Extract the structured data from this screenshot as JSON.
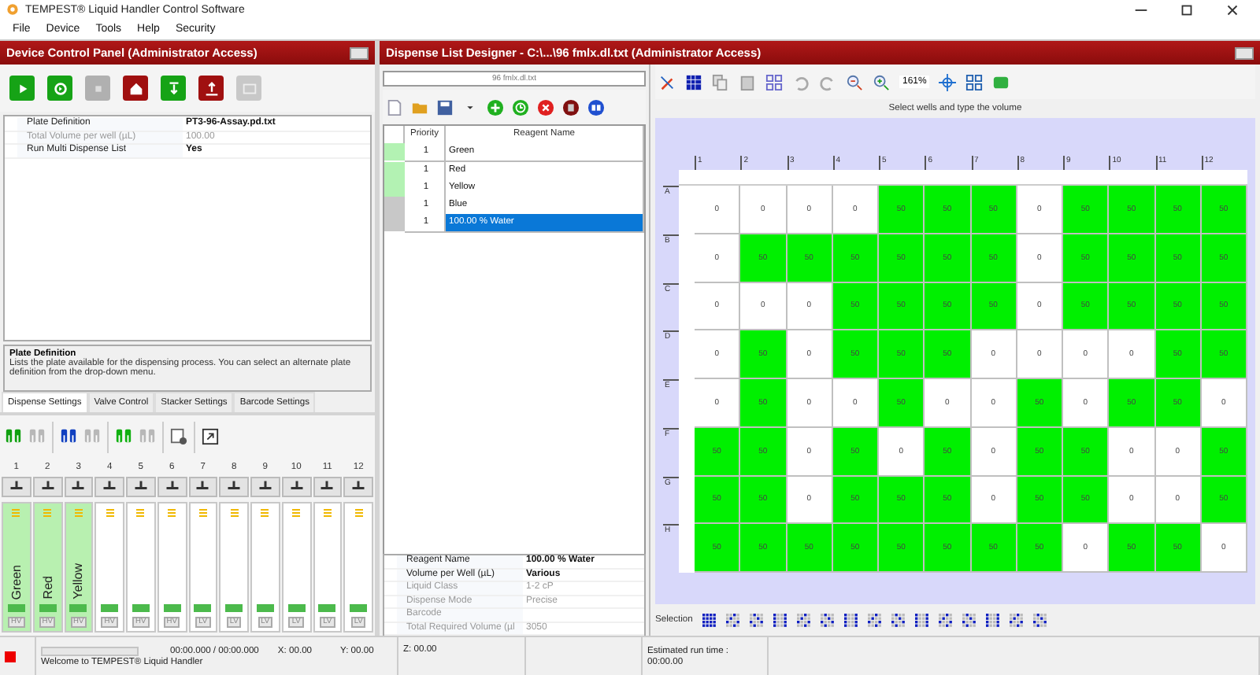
{
  "window": {
    "title": "TEMPEST® Liquid Handler Control Software"
  },
  "menu": [
    "File",
    "Device",
    "Tools",
    "Help",
    "Security"
  ],
  "device_panel": {
    "title": "Device Control Panel (Administrator Access)",
    "properties": [
      {
        "label": "Plate Definition",
        "value": "PT3-96-Assay.pd.txt",
        "disabled": false
      },
      {
        "label": "Total Volume per well (µL)",
        "value": "100.00",
        "disabled": true
      },
      {
        "label": "Run Multi Dispense List",
        "value": "Yes",
        "disabled": false
      }
    ],
    "help": {
      "title": "Plate Definition",
      "text": "Lists the plate available for the dispensing process. You can select an alternate plate definition from the drop-down menu."
    },
    "tabs": [
      {
        "label": "Dispense Settings",
        "selected": true
      },
      {
        "label": "Valve Control",
        "selected": false
      },
      {
        "label": "Stacker Settings",
        "selected": false
      },
      {
        "label": "Barcode Settings",
        "selected": false
      }
    ],
    "channels": [
      {
        "number": "1",
        "reagent": "Green",
        "valve": "HV",
        "loaded": true
      },
      {
        "number": "2",
        "reagent": "Red",
        "valve": "HV",
        "loaded": true
      },
      {
        "number": "3",
        "reagent": "Yellow",
        "valve": "HV",
        "loaded": true
      },
      {
        "number": "4",
        "valve": "HV",
        "loaded": false
      },
      {
        "number": "5",
        "valve": "HV",
        "loaded": false
      },
      {
        "number": "6",
        "valve": "HV",
        "loaded": false
      },
      {
        "number": "7",
        "valve": "LV",
        "loaded": false
      },
      {
        "number": "8",
        "valve": "LV",
        "loaded": false
      },
      {
        "number": "9",
        "valve": "LV",
        "loaded": false
      },
      {
        "number": "10",
        "valve": "LV",
        "loaded": false
      },
      {
        "number": "11",
        "valve": "LV",
        "loaded": false
      },
      {
        "number": "12",
        "valve": "LV",
        "loaded": false
      }
    ]
  },
  "designer": {
    "title": "Dispense List Designer - C:\\...\\96 fmlx.dl.txt (Administrator Access)",
    "file": "96 fmlx.dl.txt",
    "zoom": "161%",
    "columns": [
      "Priority",
      "Reagent Name"
    ],
    "rows": [
      {
        "priority": "1",
        "name": "Green",
        "color": "#b3f2b3",
        "selected": false
      },
      {
        "priority": "1",
        "name": "Red",
        "color": "#b3f2b3",
        "selected": false
      },
      {
        "priority": "1",
        "name": "Yellow",
        "color": "#b3f2b3",
        "selected": false
      },
      {
        "priority": "1",
        "name": "Blue",
        "color": "#c8c8c8",
        "selected": false
      },
      {
        "priority": "1",
        "name": "100.00 % Water",
        "color": "#c8c8c8",
        "selected": true
      }
    ],
    "properties": [
      {
        "label": "Reagent Name",
        "value": "100.00 % Water",
        "disabled": false
      },
      {
        "label": "Volume per Well (µL)",
        "value": "Various",
        "disabled": false
      },
      {
        "label": "Liquid Class",
        "value": "1-2 cP",
        "disabled": true
      },
      {
        "label": "Dispense Mode",
        "value": "Precise",
        "disabled": true
      },
      {
        "label": "Barcode",
        "disabled": true
      },
      {
        "label": "Total Required Volume (µl",
        "value": "3050",
        "disabled": true
      }
    ]
  },
  "plate": {
    "instruction": "Select wells and type the volume",
    "selection_label": "Selection",
    "columns": [
      "1",
      "2",
      "3",
      "4",
      "5",
      "6",
      "7",
      "8",
      "9",
      "10",
      "11",
      "12"
    ],
    "rows": [
      {
        "label": "A",
        "wells": "0 0 0 0 50 50 50 0 50 50 50 50"
      },
      {
        "label": "B",
        "wells": "0 50 50 50 50 50 50 0 50 50 50 50"
      },
      {
        "label": "C",
        "wells": "0 0 0 50 50 50 50 0 50 50 50 50"
      },
      {
        "label": "D",
        "wells": "0 50 0 50 50 50 0 0 0 0 50 50"
      },
      {
        "label": "E",
        "wells": "0 50 0 0 50 0 0 50 0 50 50 0"
      },
      {
        "label": "F",
        "wells": "50 50 0 50 0 50 0 50 50 0 0 50"
      },
      {
        "label": "G",
        "wells": "50 50 0 50 50 50 0 50 50 0 0 50"
      },
      {
        "label": "H",
        "wells": "50 50 50 50 50 50 50 50 0 50 50 0"
      }
    ]
  },
  "status_bar": {
    "progress": {
      "level": 0
    },
    "time": "00:00.000 / 00:00.000",
    "x": "X: 00.00",
    "y": "Y: 00.00",
    "z": "Z: 00.00",
    "message": "Welcome to TEMPEST® Liquid Handler",
    "estimate_label": "Estimated run time :",
    "estimate": "00:00.00"
  }
}
